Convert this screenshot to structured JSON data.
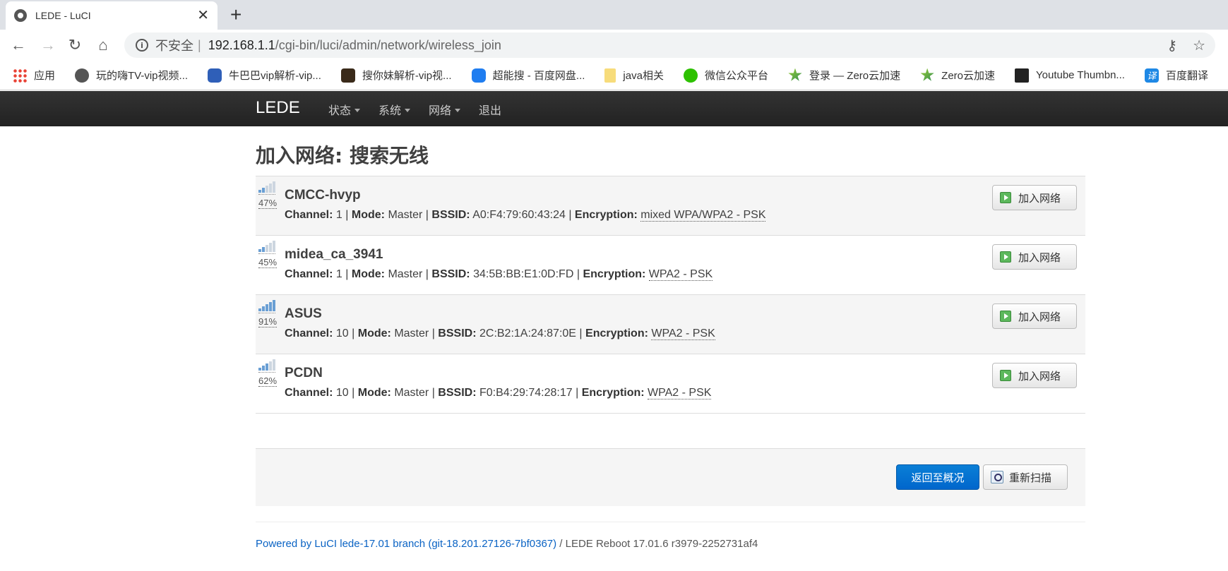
{
  "browser": {
    "tab_title": "LEDE - LuCI",
    "tab_close": "✕",
    "new_tab": "+",
    "insecure_label": "不安全",
    "separator": "|",
    "url_host": "192.168.1.1",
    "url_path": "/cgi-bin/luci/admin/network/wireless_join",
    "bookmarks": [
      {
        "label": "应用",
        "icon": "apps-icon"
      },
      {
        "label": "玩的嗨TV-vip视频...",
        "icon": "globe-icon"
      },
      {
        "label": "牛巴巴vip解析-vip...",
        "icon": "play-icon"
      },
      {
        "label": "搜你妹解析-vip视...",
        "icon": "crown-icon"
      },
      {
        "label": "超能搜 - 百度网盘...",
        "icon": "cloud-icon"
      },
      {
        "label": "java相关",
        "icon": "folder-icon"
      },
      {
        "label": "微信公众平台",
        "icon": "wechat-icon"
      },
      {
        "label": "登录 — Zero云加速",
        "icon": "star-icon"
      },
      {
        "label": "Zero云加速",
        "icon": "star-icon"
      },
      {
        "label": "Youtube Thumbn...",
        "icon": "youtube-icon"
      },
      {
        "label": "百度翻译",
        "icon": "translate-icon",
        "glyph": "译"
      }
    ]
  },
  "navbar": {
    "brand": "LEDE",
    "menu": [
      "状态",
      "系统",
      "网络",
      "退出"
    ]
  },
  "page": {
    "title": "加入网络: 搜索无线",
    "labels": {
      "channel": "Channel:",
      "mode": "Mode:",
      "bssid": "BSSID:",
      "encryption": "Encryption:",
      "pipe": "|"
    },
    "join_label": "加入网络",
    "networks": [
      {
        "ssid": "CMCC-hvyp",
        "signal": "47%",
        "signal_level": 0.47,
        "channel": "1",
        "mode": "Master",
        "bssid": "A0:F4:79:60:43:24",
        "encryption": "mixed WPA/WPA2 - PSK"
      },
      {
        "ssid": "midea_ca_3941",
        "signal": "45%",
        "signal_level": 0.45,
        "channel": "1",
        "mode": "Master",
        "bssid": "34:5B:BB:E1:0D:FD",
        "encryption": "WPA2 - PSK"
      },
      {
        "ssid": "ASUS",
        "signal": "91%",
        "signal_level": 0.91,
        "channel": "10",
        "mode": "Master",
        "bssid": "2C:B2:1A:24:87:0E",
        "encryption": "WPA2 - PSK"
      },
      {
        "ssid": "PCDN",
        "signal": "62%",
        "signal_level": 0.62,
        "channel": "10",
        "mode": "Master",
        "bssid": "F0:B4:29:74:28:17",
        "encryption": "WPA2 - PSK"
      }
    ],
    "back_button": "返回至概况",
    "rescan_button": "重新扫描"
  },
  "footer": {
    "link_text": "Powered by LuCI lede-17.01 branch (git-18.201.27126-7bf0367)",
    "rest_text": " / LEDE Reboot 17.01.6 r3979-2252731af4"
  }
}
